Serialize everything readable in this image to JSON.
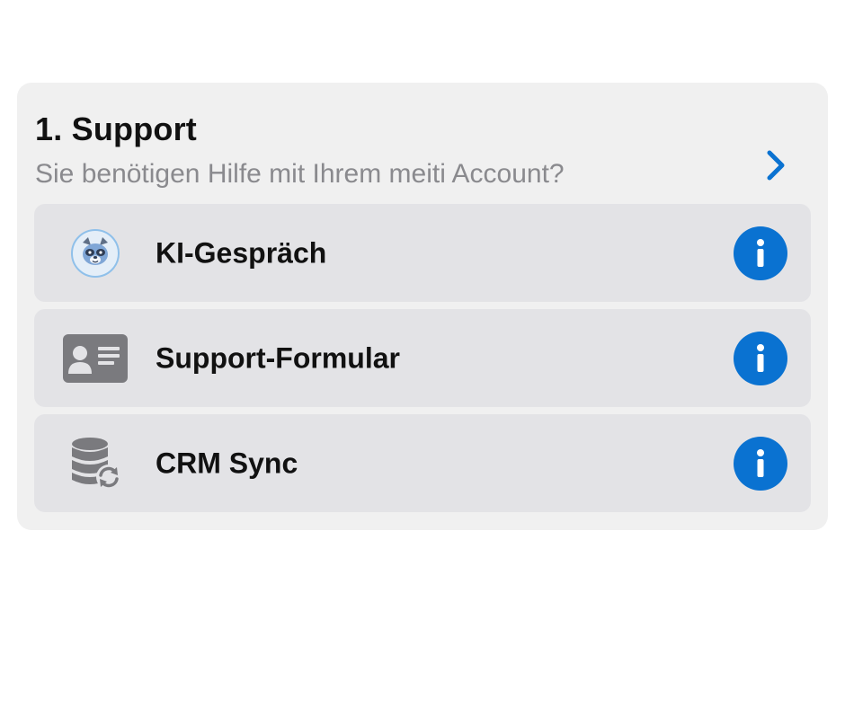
{
  "section": {
    "title": "1. Support",
    "subtitle": "Sie benötigen Hilfe mit Ihrem meiti Account?",
    "chevron_icon": "chevron-right-icon"
  },
  "items": [
    {
      "label": "KI-Gespräch",
      "icon": "raccoon-avatar-icon",
      "action_icon": "info-icon"
    },
    {
      "label": "Support-Formular",
      "icon": "contact-card-icon",
      "action_icon": "info-icon"
    },
    {
      "label": "CRM Sync",
      "icon": "database-sync-icon",
      "action_icon": "info-icon"
    }
  ],
  "colors": {
    "accent": "#0a72d1",
    "card_bg": "#f0f0f0",
    "row_bg": "#e3e3e6",
    "subtitle": "#8a8a8e",
    "icon_gray": "#7a7a7e"
  }
}
